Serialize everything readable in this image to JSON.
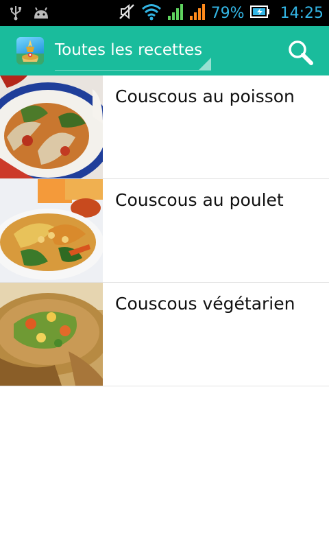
{
  "status_bar": {
    "battery_percent": "79%",
    "time": "14:25",
    "icons": [
      "usb-icon",
      "android-debug-icon",
      "mute-icon",
      "wifi-icon",
      "signal-green-icon",
      "signal-orange-icon",
      "battery-icon"
    ],
    "accent_color": "#33b5e5"
  },
  "action_bar": {
    "color": "#1abc9c",
    "spinner_label": "Toutes les recettes",
    "search_icon": "search-icon"
  },
  "recipes": [
    {
      "title": "Couscous au poisson"
    },
    {
      "title": "Couscous au poulet"
    },
    {
      "title": "Couscous végétarien"
    }
  ]
}
